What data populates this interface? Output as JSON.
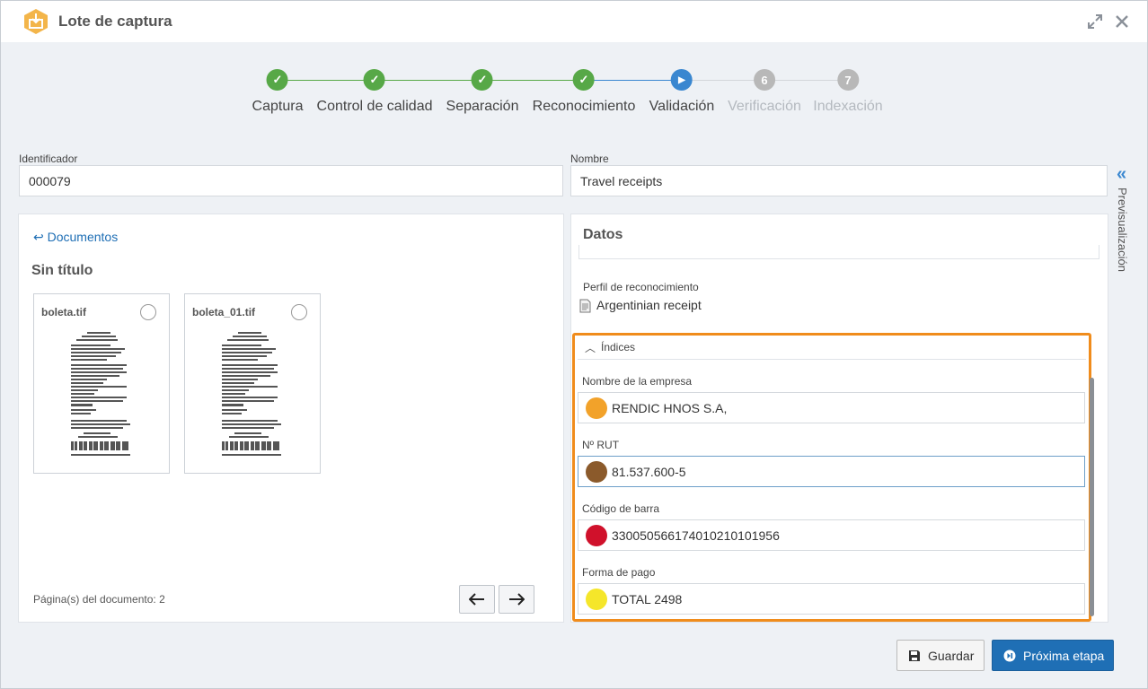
{
  "window": {
    "title": "Lote de captura"
  },
  "stepper": {
    "steps": [
      {
        "label": "Captura",
        "state": "done",
        "marker": "✓"
      },
      {
        "label": "Control de calidad",
        "state": "done",
        "marker": "✓"
      },
      {
        "label": "Separación",
        "state": "done",
        "marker": "✓"
      },
      {
        "label": "Reconocimiento",
        "state": "done",
        "marker": "✓"
      },
      {
        "label": "Validación",
        "state": "current",
        "marker": "▶"
      },
      {
        "label": "Verificación",
        "state": "pending",
        "marker": "6"
      },
      {
        "label": "Indexación",
        "state": "pending",
        "marker": "7"
      }
    ]
  },
  "form": {
    "identificador_label": "Identificador",
    "identificador_value": "000079",
    "nombre_label": "Nombre",
    "nombre_value": "Travel receipts"
  },
  "side_tab": {
    "label": "Previsualización"
  },
  "documents": {
    "back_link": "↩ Documentos",
    "section_title": "Sin título",
    "files": [
      {
        "name": "boleta.tif"
      },
      {
        "name": "boleta_01.tif"
      }
    ],
    "pages_text": "Página(s) del documento: 2"
  },
  "datos": {
    "title": "Datos",
    "profile_label": "Perfil de reconocimiento",
    "profile_value": "Argentinian receipt",
    "indices_label": "Índices",
    "fields": [
      {
        "label": "Nombre de la empresa",
        "value": "RENDIC HNOS S.A,",
        "color": "#f2a22a"
      },
      {
        "label": "Nº RUT",
        "value": "81.537.600-5",
        "color": "#8b5a2b"
      },
      {
        "label": "Código de barra",
        "value": "3300505661740102101019​56",
        "color": "#d0112b"
      },
      {
        "label": "Forma de pago",
        "value": "TOTAL 2498",
        "color": "#f5e62a"
      }
    ]
  },
  "buttons": {
    "save": "Guardar",
    "next": "Próxima etapa"
  },
  "colors": {
    "accent": "#1f6fb5",
    "highlight": "#f08c1c",
    "done": "#57a847"
  }
}
